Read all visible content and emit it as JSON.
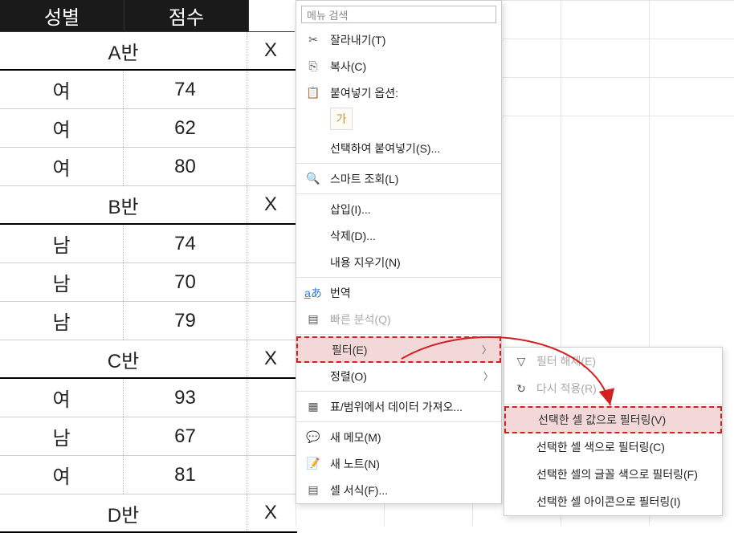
{
  "header": {
    "col1": "성별",
    "col2": "점수"
  },
  "x_marker": "X",
  "rows": [
    {
      "type": "group",
      "label": "A반",
      "x": "X"
    },
    {
      "type": "data",
      "c1": "여",
      "c2": "74"
    },
    {
      "type": "data",
      "c1": "여",
      "c2": "62"
    },
    {
      "type": "data",
      "c1": "여",
      "c2": "80"
    },
    {
      "type": "group",
      "label": "B반",
      "x": "X"
    },
    {
      "type": "data",
      "c1": "남",
      "c2": "74"
    },
    {
      "type": "data",
      "c1": "남",
      "c2": "70"
    },
    {
      "type": "data",
      "c1": "남",
      "c2": "79"
    },
    {
      "type": "group",
      "label": "C반",
      "x": "X"
    },
    {
      "type": "data",
      "c1": "여",
      "c2": "93"
    },
    {
      "type": "data",
      "c1": "남",
      "c2": "67"
    },
    {
      "type": "data",
      "c1": "여",
      "c2": "81"
    },
    {
      "type": "group",
      "label": "D반",
      "x": "X"
    }
  ],
  "menu": {
    "search_placeholder": "메뉴 검색",
    "cut": "잘라내기(T)",
    "copy": "복사(C)",
    "paste_options": "붙여넣기 옵션:",
    "paste_special": "선택하여 붙여넣기(S)...",
    "smart_lookup": "스마트 조회(L)",
    "insert": "삽입(I)...",
    "delete": "삭제(D)...",
    "clear": "내용 지우기(N)",
    "translate": "번역",
    "quick_analysis": "빠른 분석(Q)",
    "filter": "필터(E)",
    "sort": "정렬(O)",
    "get_data": "표/범위에서 데이터 가져오...",
    "new_comment": "새 메모(M)",
    "new_note": "새 노트(N)",
    "format_cells": "셀 서식(F)..."
  },
  "submenu": {
    "clear_filter": "필터 해제(E)",
    "reapply": "다시 적용(R)",
    "filter_by_value": "선택한 셀 값으로 필터링(V)",
    "filter_by_color": "선택한 셀 색으로 필터링(C)",
    "filter_by_font": "선택한 셀의 글꼴 색으로 필터링(F)",
    "filter_by_icon": "선택한 셀 아이콘으로 필터링(I)"
  },
  "paste_icon_label": "가"
}
